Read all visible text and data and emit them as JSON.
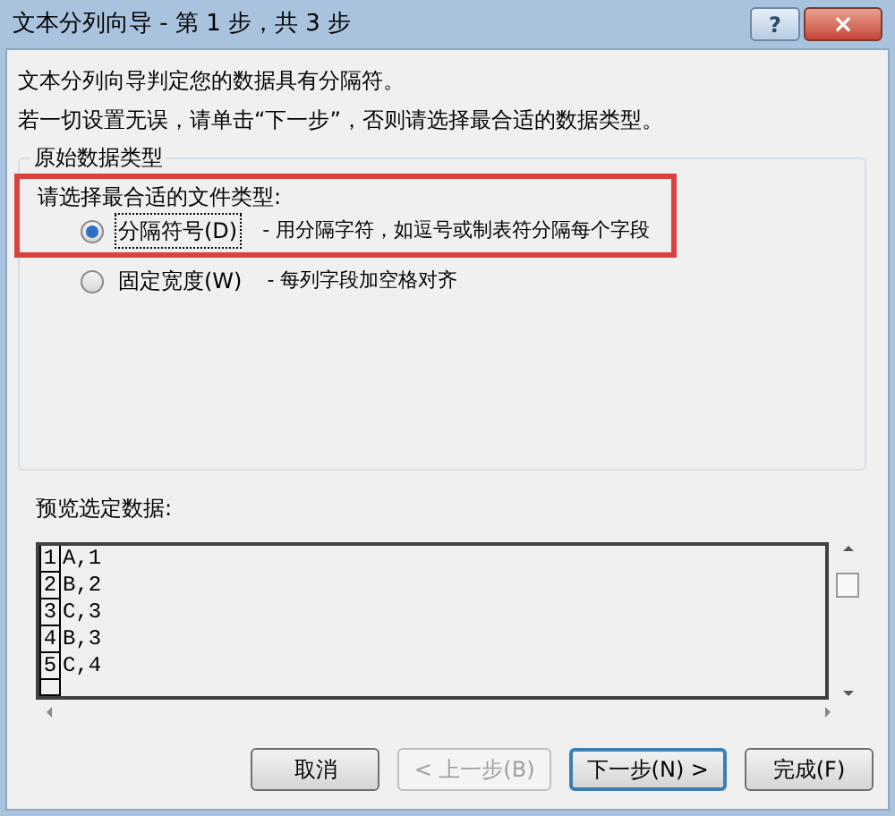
{
  "window": {
    "title": "文本分列向导 - 第 1 步，共 3 步",
    "help": "?",
    "close": "×"
  },
  "intro": [
    "文本分列向导判定您的数据具有分隔符。",
    "若一切设置无误，请单击“下一步”，否则请选择最合适的数据类型。"
  ],
  "group": {
    "title": "原始数据类型",
    "prompt": "请选择最合适的文件类型:",
    "options": [
      {
        "label": "分隔符号(D)",
        "description": "- 用分隔字符，如逗号或制表符分隔每个字段",
        "selected": true
      },
      {
        "label": "固定宽度(W)",
        "description": "- 每列字段加空格对齐",
        "selected": false
      }
    ]
  },
  "preview": {
    "label": "预览选定数据:",
    "rows": [
      {
        "number": "1",
        "text": "A,1"
      },
      {
        "number": "2",
        "text": "B,2"
      },
      {
        "number": "3",
        "text": "C,3"
      },
      {
        "number": "4",
        "text": "B,3"
      },
      {
        "number": "5",
        "text": "C,4"
      }
    ]
  },
  "buttons": [
    {
      "label": "取消",
      "disabled": false,
      "default": false
    },
    {
      "label": "< 上一步(B)",
      "disabled": true,
      "default": false
    },
    {
      "label": "下一步(N) >",
      "disabled": false,
      "default": true
    },
    {
      "label": "完成(F)",
      "disabled": false,
      "default": false
    }
  ]
}
